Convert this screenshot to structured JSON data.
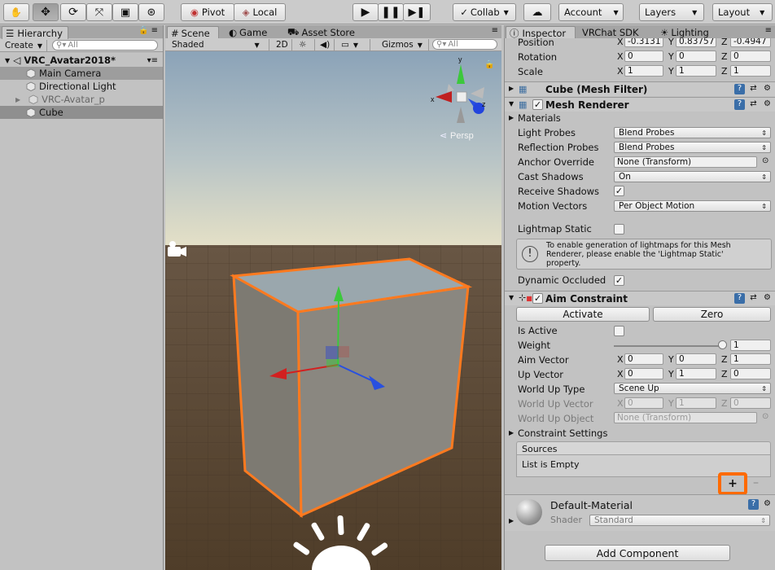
{
  "toolbar": {
    "pivot_label": "Pivot",
    "local_label": "Local",
    "collab_label": "Collab",
    "account_label": "Account",
    "layers_label": "Layers",
    "layout_label": "Layout"
  },
  "hierarchy": {
    "tab_label": "Hierarchy",
    "create_label": "Create",
    "search_placeholder": "All",
    "scene_name": "VRC_Avatar2018*",
    "items": [
      {
        "label": "Main Camera"
      },
      {
        "label": "Directional Light"
      },
      {
        "label": "VRC-Avatar_p"
      },
      {
        "label": "Cube"
      }
    ]
  },
  "scene": {
    "tabs": [
      "Scene",
      "Game",
      "Asset Store"
    ],
    "shading_mode": "Shaded",
    "mode_2d": "2D",
    "gizmos_label": "Gizmos",
    "search_placeholder": "All",
    "persp_label": "Persp",
    "axis_x": "x",
    "axis_y": "y",
    "axis_z": "z"
  },
  "inspector": {
    "tabs": [
      "Inspector",
      "VRChat SDK",
      "Lighting"
    ],
    "transform": {
      "position": {
        "label": "Position",
        "x": "-0.3131",
        "y": "0.83757",
        "z": "-0.4947"
      },
      "rotation": {
        "label": "Rotation",
        "x": "0",
        "y": "0",
        "z": "0"
      },
      "scale": {
        "label": "Scale",
        "x": "1",
        "y": "1",
        "z": "1"
      }
    },
    "mesh_filter": {
      "title": "Cube (Mesh Filter)"
    },
    "mesh_renderer": {
      "title": "Mesh Renderer",
      "materials_label": "Materials",
      "light_probes": {
        "label": "Light Probes",
        "value": "Blend Probes"
      },
      "reflection_probes": {
        "label": "Reflection Probes",
        "value": "Blend Probes"
      },
      "anchor_override": {
        "label": "Anchor Override",
        "value": "None (Transform)"
      },
      "cast_shadows": {
        "label": "Cast Shadows",
        "value": "On"
      },
      "receive_shadows": {
        "label": "Receive Shadows"
      },
      "motion_vectors": {
        "label": "Motion Vectors",
        "value": "Per Object Motion"
      },
      "lightmap_static": {
        "label": "Lightmap Static"
      },
      "info_line1": "To enable generation of lightmaps for this Mesh",
      "info_line2": "Renderer, please enable the 'Lightmap Static'",
      "info_line3": "property.",
      "dynamic_occluded": {
        "label": "Dynamic Occluded"
      }
    },
    "aim_constraint": {
      "title": "Aim Constraint",
      "activate_label": "Activate",
      "zero_label": "Zero",
      "is_active": {
        "label": "Is Active"
      },
      "weight": {
        "label": "Weight",
        "value": "1"
      },
      "aim_vector": {
        "label": "Aim Vector",
        "x": "0",
        "y": "0",
        "z": "1"
      },
      "up_vector": {
        "label": "Up Vector",
        "x": "0",
        "y": "1",
        "z": "0"
      },
      "world_up_type": {
        "label": "World Up Type",
        "value": "Scene Up"
      },
      "world_up_vector": {
        "label": "World Up Vector",
        "x": "0",
        "y": "1",
        "z": "0"
      },
      "world_up_object": {
        "label": "World Up Object",
        "value": "None (Transform)"
      },
      "constraint_settings": "Constraint Settings",
      "sources_label": "Sources",
      "list_empty": "List is Empty"
    },
    "material": {
      "name": "Default-Material",
      "shader_label": "Shader",
      "shader_value": "Standard"
    },
    "add_component_label": "Add Component"
  },
  "colors": {
    "selection_outline": "#ff7a1f",
    "highlight_box": "#ff6a00",
    "x_axis": "#d22020",
    "y_axis": "#3cc83c",
    "z_axis": "#2850e0"
  }
}
